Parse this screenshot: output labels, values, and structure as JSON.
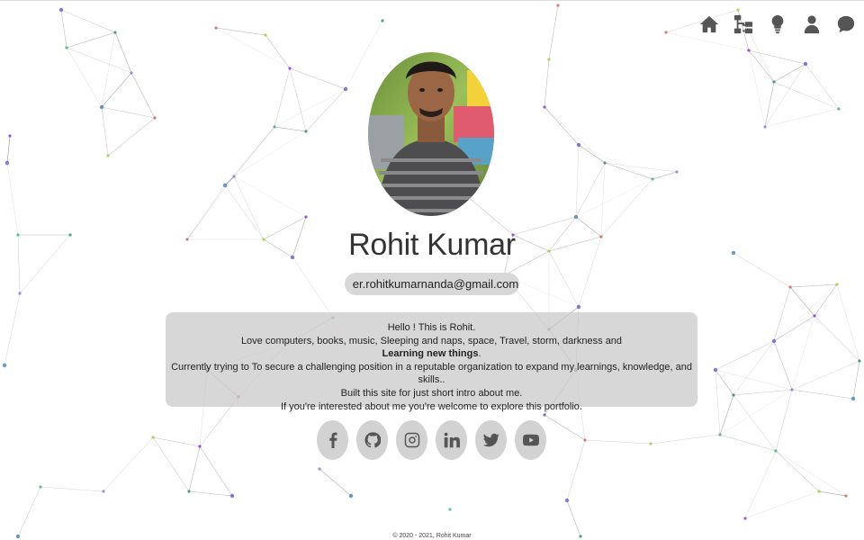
{
  "nav": {
    "items": [
      {
        "name": "home",
        "icon": "home-icon"
      },
      {
        "name": "projects",
        "icon": "sitemap-icon"
      },
      {
        "name": "ideas",
        "icon": "lightbulb-icon"
      },
      {
        "name": "about",
        "icon": "user-icon"
      },
      {
        "name": "contact",
        "icon": "chat-bubble-icon"
      }
    ]
  },
  "profile": {
    "name": "Rohit Kumar",
    "email": "er.rohitkumarnanda@gmail.com",
    "email_icon": "envelope-icon"
  },
  "bio": {
    "line1": "Hello ! This is Rohit.",
    "line2": "Love computers, books, music, Sleeping and naps, space, Travel, storm, darkness and",
    "line3": "Learning new things",
    "line3_suffix": ".",
    "line4": "Currently trying to To secure a challenging position in a reputable organization to expand my learnings, knowledge, and skills..",
    "line5": "Built this site for just short intro about me.",
    "line6": "If you're interested about me you're welcome to explore this portfolio."
  },
  "social": [
    {
      "name": "facebook",
      "icon": "facebook-icon"
    },
    {
      "name": "github",
      "icon": "github-icon"
    },
    {
      "name": "instagram",
      "icon": "instagram-icon"
    },
    {
      "name": "linkedin",
      "icon": "linkedin-icon"
    },
    {
      "name": "twitter",
      "icon": "twitter-icon"
    },
    {
      "name": "youtube",
      "icon": "youtube-icon"
    }
  ],
  "footer": {
    "text": "© 2020 - 2021, Rohit Kumar"
  },
  "colors": {
    "icon": "#555555",
    "pill": "#d8d8d8",
    "card": "#c8c8c8",
    "network_line": "#9a9a9a"
  }
}
